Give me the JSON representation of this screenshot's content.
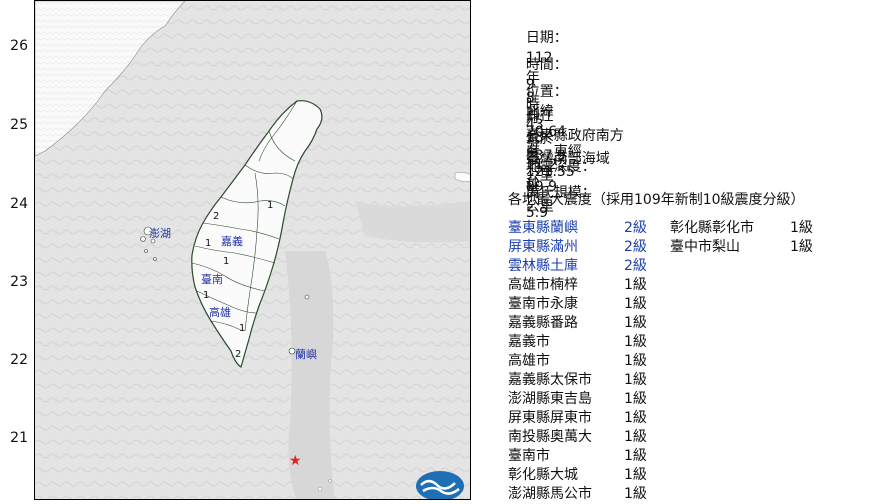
{
  "map": {
    "latitudes": [
      "26",
      "25",
      "24",
      "23",
      "22",
      "21"
    ],
    "town_labels": [
      {
        "id": "penghu",
        "text": "澎湖"
      },
      {
        "id": "chiayi",
        "text": "嘉義"
      },
      {
        "id": "tainan",
        "text": "臺南"
      },
      {
        "id": "kaohsiung",
        "text": "高雄"
      },
      {
        "id": "lanyu",
        "text": "蘭嶼"
      }
    ],
    "epicenter_marker": "★",
    "colors": {
      "sea": "#e9e9e9",
      "land": "#fbfbfb",
      "border": "#2c4a2c",
      "epicenter": "#e52020",
      "text_blue": "#1a3fb0"
    }
  },
  "info": {
    "date": {
      "label": "日期：",
      "year": "112",
      "y": "年",
      "month": "8",
      "m": "月",
      "day": "13",
      "d": "日"
    },
    "time": {
      "label": "時間：",
      "hour": "9",
      "h": "時",
      "minute": "43",
      "mi": "分",
      "second": "11.2",
      "s": "秒"
    },
    "location": {
      "label": "位置：",
      "lat_prefix": "北緯",
      "lat": "20.64",
      "lat_unit": "度．東經",
      "lon": "121.55",
      "lon_unit": "度"
    },
    "relative": {
      "label": "即在",
      "place": "臺東縣政府南方",
      "distance": "237.9",
      "unit": "公里"
    },
    "region": {
      "label": "位於",
      "value": "臺灣南部海域"
    },
    "depth": {
      "label": "地震深度：",
      "value": "89.9",
      "unit": "公里"
    },
    "magnitude": {
      "label": "芮氏規模：",
      "value": "5.9"
    },
    "intensity_title": "各地最大震度（採用109年新制10級震度分級）"
  },
  "intensities_left": [
    {
      "place": "臺東縣蘭嶼",
      "level": "2級",
      "highlight": true
    },
    {
      "place": "屏東縣滿州",
      "level": "2級",
      "highlight": true
    },
    {
      "place": "雲林縣土庫",
      "level": "2級",
      "highlight": true
    },
    {
      "place": "高雄市楠梓",
      "level": "1級",
      "highlight": false
    },
    {
      "place": "臺南市永康",
      "level": "1級",
      "highlight": false
    },
    {
      "place": "嘉義縣番路",
      "level": "1級",
      "highlight": false
    },
    {
      "place": "嘉義市",
      "level": "1級",
      "highlight": false
    },
    {
      "place": "高雄市",
      "level": "1級",
      "highlight": false
    },
    {
      "place": "嘉義縣太保市",
      "level": "1級",
      "highlight": false
    },
    {
      "place": "澎湖縣東吉島",
      "level": "1級",
      "highlight": false
    },
    {
      "place": "屏東縣屏東市",
      "level": "1級",
      "highlight": false
    },
    {
      "place": "南投縣奧萬大",
      "level": "1級",
      "highlight": false
    },
    {
      "place": "臺南市",
      "level": "1級",
      "highlight": false
    },
    {
      "place": "彰化縣大城",
      "level": "1級",
      "highlight": false
    },
    {
      "place": "澎湖縣馬公市",
      "level": "1級",
      "highlight": false
    }
  ],
  "intensities_right": [
    {
      "place": "彰化縣彰化市",
      "level": "1級"
    },
    {
      "place": "臺中市梨山",
      "level": "1級"
    }
  ]
}
